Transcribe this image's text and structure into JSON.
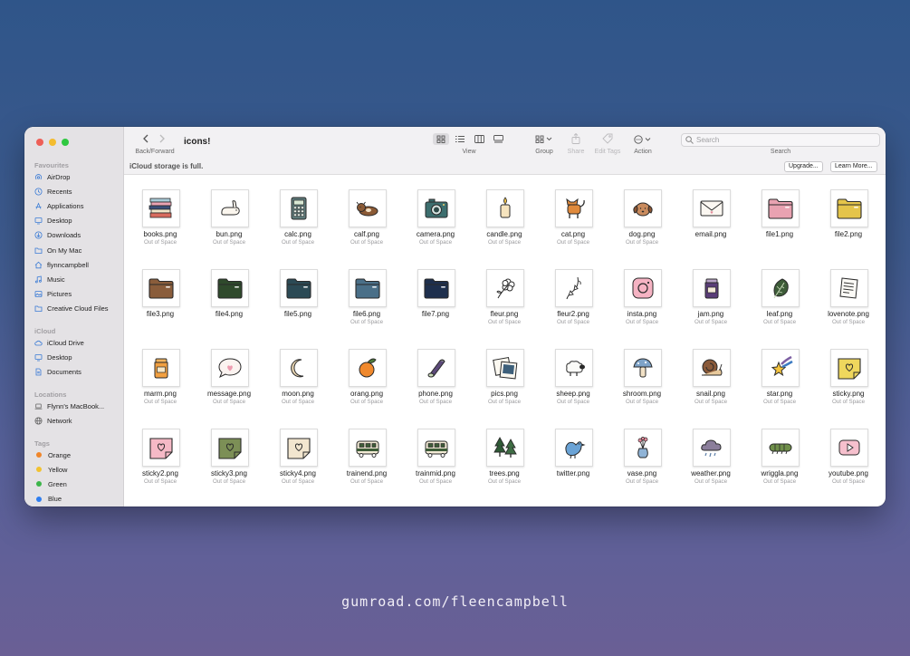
{
  "window": {
    "title": "icons!",
    "info_message": "iCloud storage is full.",
    "upgrade_label": "Upgrade...",
    "learn_more_label": "Learn More..."
  },
  "toolbar": {
    "back_forward_label": "Back/Forward",
    "view_label": "View",
    "group_label": "Group",
    "share_label": "Share",
    "edit_tags_label": "Edit Tags",
    "action_label": "Action",
    "search_label": "Search",
    "search_placeholder": "Search"
  },
  "sidebar": {
    "favourites_title": "Favourites",
    "favourites": [
      {
        "label": "AirDrop",
        "icon": "airdrop-icon"
      },
      {
        "label": "Recents",
        "icon": "clock-icon"
      },
      {
        "label": "Applications",
        "icon": "applications-icon"
      },
      {
        "label": "Desktop",
        "icon": "desktop-icon"
      },
      {
        "label": "Downloads",
        "icon": "download-icon"
      },
      {
        "label": "On My Mac",
        "icon": "folder-icon"
      },
      {
        "label": "flynncampbell",
        "icon": "home-icon"
      },
      {
        "label": "Music",
        "icon": "music-icon"
      },
      {
        "label": "Pictures",
        "icon": "pictures-icon"
      },
      {
        "label": "Creative Cloud Files",
        "icon": "folder-icon"
      }
    ],
    "icloud_title": "iCloud",
    "icloud": [
      {
        "label": "iCloud Drive",
        "icon": "cloud-icon"
      },
      {
        "label": "Desktop",
        "icon": "desktop-icon"
      },
      {
        "label": "Documents",
        "icon": "document-icon"
      }
    ],
    "locations_title": "Locations",
    "locations": [
      {
        "label": "Flynn's MacBook...",
        "icon": "laptop-icon"
      },
      {
        "label": "Network",
        "icon": "globe-icon"
      }
    ],
    "tags_title": "Tags",
    "tags": [
      {
        "label": "Orange",
        "color": "#f0862a"
      },
      {
        "label": "Yellow",
        "color": "#f2c230"
      },
      {
        "label": "Green",
        "color": "#3cb54a"
      },
      {
        "label": "Blue",
        "color": "#2f7ef0"
      }
    ]
  },
  "files": [
    {
      "name": "books.png",
      "status": "Out of Space",
      "icon": "books"
    },
    {
      "name": "bun.png",
      "status": "Out of Space",
      "icon": "bun"
    },
    {
      "name": "calc.png",
      "status": "Out of Space",
      "icon": "calc"
    },
    {
      "name": "calf.png",
      "status": "Out of Space",
      "icon": "calf"
    },
    {
      "name": "camera.png",
      "status": "Out of Space",
      "icon": "camera"
    },
    {
      "name": "candle.png",
      "status": "Out of Space",
      "icon": "candle"
    },
    {
      "name": "cat.png",
      "status": "Out of Space",
      "icon": "cat"
    },
    {
      "name": "dog.png",
      "status": "Out of Space",
      "icon": "dog"
    },
    {
      "name": "email.png",
      "status": "",
      "icon": "email"
    },
    {
      "name": "file1.png",
      "status": "",
      "icon": "folder",
      "color": "#e9a2b1"
    },
    {
      "name": "file2.png",
      "status": "",
      "icon": "folder",
      "color": "#e4c44a"
    },
    {
      "name": "file3.png",
      "status": "",
      "icon": "folder",
      "color": "#8a5d3b"
    },
    {
      "name": "file4.png",
      "status": "",
      "icon": "folder",
      "color": "#2f4a2c"
    },
    {
      "name": "file5.png",
      "status": "",
      "icon": "folder",
      "color": "#2b4a55"
    },
    {
      "name": "file6.png",
      "status": "Out of Space",
      "icon": "folder",
      "color": "#4a6f88"
    },
    {
      "name": "file7.png",
      "status": "",
      "icon": "folder",
      "color": "#1e2f4d"
    },
    {
      "name": "fleur.png",
      "status": "Out of Space",
      "icon": "fleur"
    },
    {
      "name": "fleur2.png",
      "status": "Out of Space",
      "icon": "fleur2"
    },
    {
      "name": "insta.png",
      "status": "Out of Space",
      "icon": "insta"
    },
    {
      "name": "jam.png",
      "status": "Out of Space",
      "icon": "jam"
    },
    {
      "name": "leaf.png",
      "status": "Out of Space",
      "icon": "leaf"
    },
    {
      "name": "lovenote.png",
      "status": "Out of Space",
      "icon": "lovenote"
    },
    {
      "name": "marm.png",
      "status": "Out of Space",
      "icon": "marm"
    },
    {
      "name": "message.png",
      "status": "Out of Space",
      "icon": "message"
    },
    {
      "name": "moon.png",
      "status": "Out of Space",
      "icon": "moon"
    },
    {
      "name": "orang.png",
      "status": "Out of Space",
      "icon": "orang"
    },
    {
      "name": "phone.png",
      "status": "Out of Space",
      "icon": "phone"
    },
    {
      "name": "pics.png",
      "status": "Out of Space",
      "icon": "pics"
    },
    {
      "name": "sheep.png",
      "status": "Out of Space",
      "icon": "sheep"
    },
    {
      "name": "shroom.png",
      "status": "Out of Space",
      "icon": "shroom"
    },
    {
      "name": "snail.png",
      "status": "Out of Space",
      "icon": "snail"
    },
    {
      "name": "star.png",
      "status": "Out of Space",
      "icon": "star"
    },
    {
      "name": "sticky.png",
      "status": "Out of Space",
      "icon": "sticky",
      "color": "#efd75d"
    },
    {
      "name": "sticky2.png",
      "status": "Out of Space",
      "icon": "sticky",
      "color": "#f5b9c6"
    },
    {
      "name": "sticky3.png",
      "status": "Out of Space",
      "icon": "sticky",
      "color": "#7c8f56"
    },
    {
      "name": "sticky4.png",
      "status": "Out of Space",
      "icon": "sticky",
      "color": "#f2e6cf"
    },
    {
      "name": "trainend.png",
      "status": "Out of Space",
      "icon": "train"
    },
    {
      "name": "trainmid.png",
      "status": "Out of Space",
      "icon": "train"
    },
    {
      "name": "trees.png",
      "status": "Out of Space",
      "icon": "trees"
    },
    {
      "name": "twitter.png",
      "status": "",
      "icon": "twitter"
    },
    {
      "name": "vase.png",
      "status": "Out of Space",
      "icon": "vase"
    },
    {
      "name": "weather.png",
      "status": "Out of Space",
      "icon": "weather"
    },
    {
      "name": "wriggla.png",
      "status": "Out of Space",
      "icon": "wriggla"
    },
    {
      "name": "youtube.png",
      "status": "Out of Space",
      "icon": "youtube"
    }
  ],
  "footer_text": "gumroad.com/fleencampbell"
}
